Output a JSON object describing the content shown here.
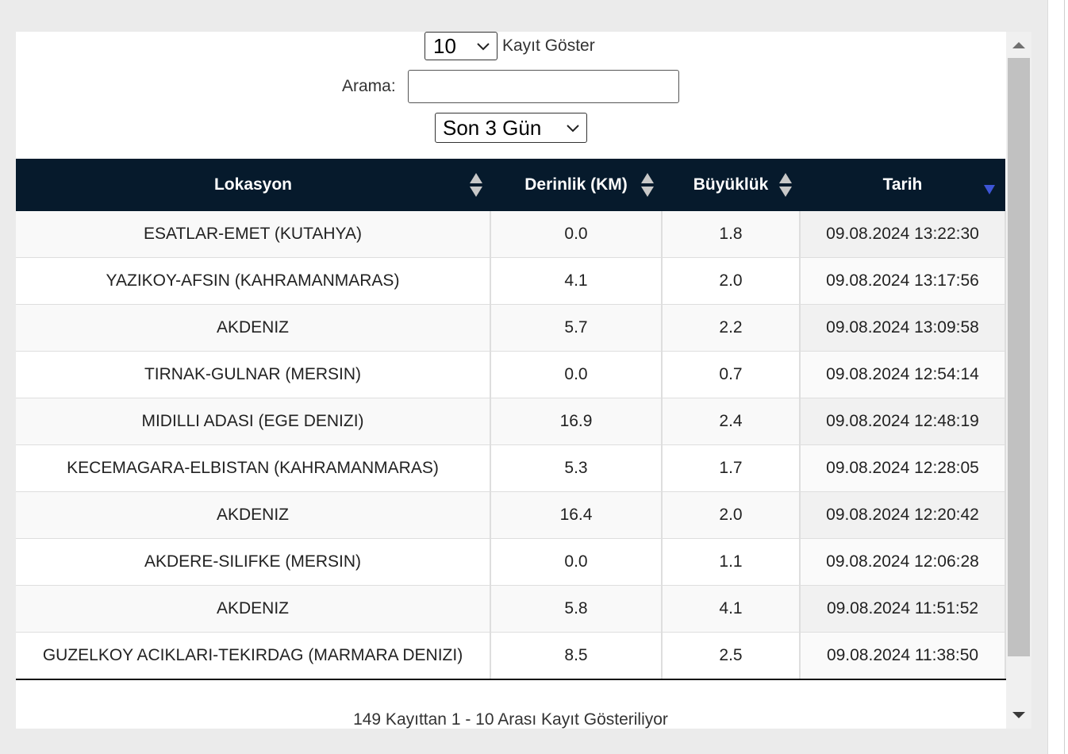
{
  "length_control": {
    "selected": "10",
    "label": "Kayıt Göster"
  },
  "search": {
    "label": "Arama:",
    "value": "",
    "placeholder": ""
  },
  "period_filter": {
    "selected": "Son 3 Gün"
  },
  "table": {
    "columns": [
      {
        "label": "Lokasyon",
        "sort": "both"
      },
      {
        "label": "Derinlik (KM)",
        "sort": "both"
      },
      {
        "label": "Büyüklük",
        "sort": "both"
      },
      {
        "label": "Tarih",
        "sort": "desc"
      }
    ],
    "rows": [
      {
        "location": "ESATLAR-EMET (KUTAHYA)",
        "depth": "0.0",
        "magnitude": "1.8",
        "date": "09.08.2024 13:22:30"
      },
      {
        "location": "YAZIKOY-AFSIN (KAHRAMANMARAS)",
        "depth": "4.1",
        "magnitude": "2.0",
        "date": "09.08.2024 13:17:56"
      },
      {
        "location": "AKDENIZ",
        "depth": "5.7",
        "magnitude": "2.2",
        "date": "09.08.2024 13:09:58"
      },
      {
        "location": "TIRNAK-GULNAR (MERSIN)",
        "depth": "0.0",
        "magnitude": "0.7",
        "date": "09.08.2024 12:54:14"
      },
      {
        "location": "MIDILLI ADASI (EGE DENIZI)",
        "depth": "16.9",
        "magnitude": "2.4",
        "date": "09.08.2024 12:48:19"
      },
      {
        "location": "KECEMAGARA-ELBISTAN (KAHRAMANMARAS)",
        "depth": "5.3",
        "magnitude": "1.7",
        "date": "09.08.2024 12:28:05"
      },
      {
        "location": "AKDENIZ",
        "depth": "16.4",
        "magnitude": "2.0",
        "date": "09.08.2024 12:20:42"
      },
      {
        "location": "AKDERE-SILIFKE (MERSIN)",
        "depth": "0.0",
        "magnitude": "1.1",
        "date": "09.08.2024 12:06:28"
      },
      {
        "location": "AKDENIZ",
        "depth": "5.8",
        "magnitude": "4.1",
        "date": "09.08.2024 11:51:52"
      },
      {
        "location": "GUZELKOY ACIKLARI-TEKIRDAG (MARMARA DENIZI)",
        "depth": "8.5",
        "magnitude": "2.5",
        "date": "09.08.2024 11:38:50"
      }
    ]
  },
  "info_text": "149 Kayıttan 1 - 10 Arası Kayıt Gösteriliyor",
  "colors": {
    "header_bg": "#061a2c",
    "sort_active": "#3d55d6",
    "sort_idle": "#c8c8c8"
  }
}
